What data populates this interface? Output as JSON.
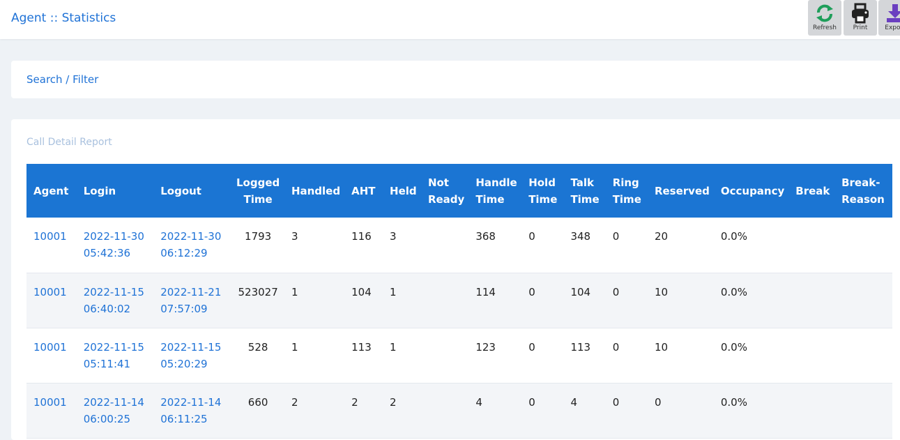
{
  "header": {
    "title": "Agent :: Statistics",
    "buttons": {
      "refresh": "Refresh",
      "print": "Print",
      "export": "Export"
    }
  },
  "filter": {
    "label": "Search / Filter"
  },
  "report": {
    "title": "Call Detail Report",
    "columns": {
      "agent": "Agent",
      "login": "Login",
      "logout": "Logout",
      "logged_time_1": "Logged",
      "logged_time_2": "Time",
      "handled": "Handled",
      "aht": "AHT",
      "held": "Held",
      "not_ready_1": "Not",
      "not_ready_2": "Ready",
      "handle_time_1": "Handle",
      "handle_time_2": "Time",
      "hold_time_1": "Hold",
      "hold_time_2": "Time",
      "talk_time_1": "Talk",
      "talk_time_2": "Time",
      "ring_time_1": "Ring",
      "ring_time_2": "Time",
      "reserved": "Reserved",
      "occupancy": "Occupancy",
      "break": "Break",
      "break_reason_1": "Break-",
      "break_reason_2": "Reason"
    },
    "rows": [
      {
        "agent": "10001",
        "login_date": "2022-11-30",
        "login_time": "05:42:36",
        "logout_date": "2022-11-30",
        "logout_time": "06:12:29",
        "logged": "1793",
        "handled": "3",
        "aht": "116",
        "held": "3",
        "not_ready": "",
        "handle_time": "368",
        "hold_time": "0",
        "talk_time": "348",
        "ring_time": "0",
        "reserved": "20",
        "occupancy": "0.0%",
        "break": "",
        "break_reason": ""
      },
      {
        "agent": "10001",
        "login_date": "2022-11-15",
        "login_time": "06:40:02",
        "logout_date": "2022-11-21",
        "logout_time": "07:57:09",
        "logged": "523027",
        "handled": "1",
        "aht": "104",
        "held": "1",
        "not_ready": "",
        "handle_time": "114",
        "hold_time": "0",
        "talk_time": "104",
        "ring_time": "0",
        "reserved": "10",
        "occupancy": "0.0%",
        "break": "",
        "break_reason": ""
      },
      {
        "agent": "10001",
        "login_date": "2022-11-15",
        "login_time": "05:11:41",
        "logout_date": "2022-11-15",
        "logout_time": "05:20:29",
        "logged": "528",
        "handled": "1",
        "aht": "113",
        "held": "1",
        "not_ready": "",
        "handle_time": "123",
        "hold_time": "0",
        "talk_time": "113",
        "ring_time": "0",
        "reserved": "10",
        "occupancy": "0.0%",
        "break": "",
        "break_reason": ""
      },
      {
        "agent": "10001",
        "login_date": "2022-11-14",
        "login_time": "06:00:25",
        "logout_date": "2022-11-14",
        "logout_time": "06:11:25",
        "logged": "660",
        "handled": "2",
        "aht": "2",
        "held": "2",
        "not_ready": "",
        "handle_time": "4",
        "hold_time": "0",
        "talk_time": "4",
        "ring_time": "0",
        "reserved": "0",
        "occupancy": "0.0%",
        "break": "",
        "break_reason": ""
      }
    ]
  },
  "colors": {
    "accent": "#1f72d6",
    "header_bg": "#1b75d3",
    "refresh_icon": "#1e9e5a",
    "export_icon": "#6a3fc0"
  }
}
